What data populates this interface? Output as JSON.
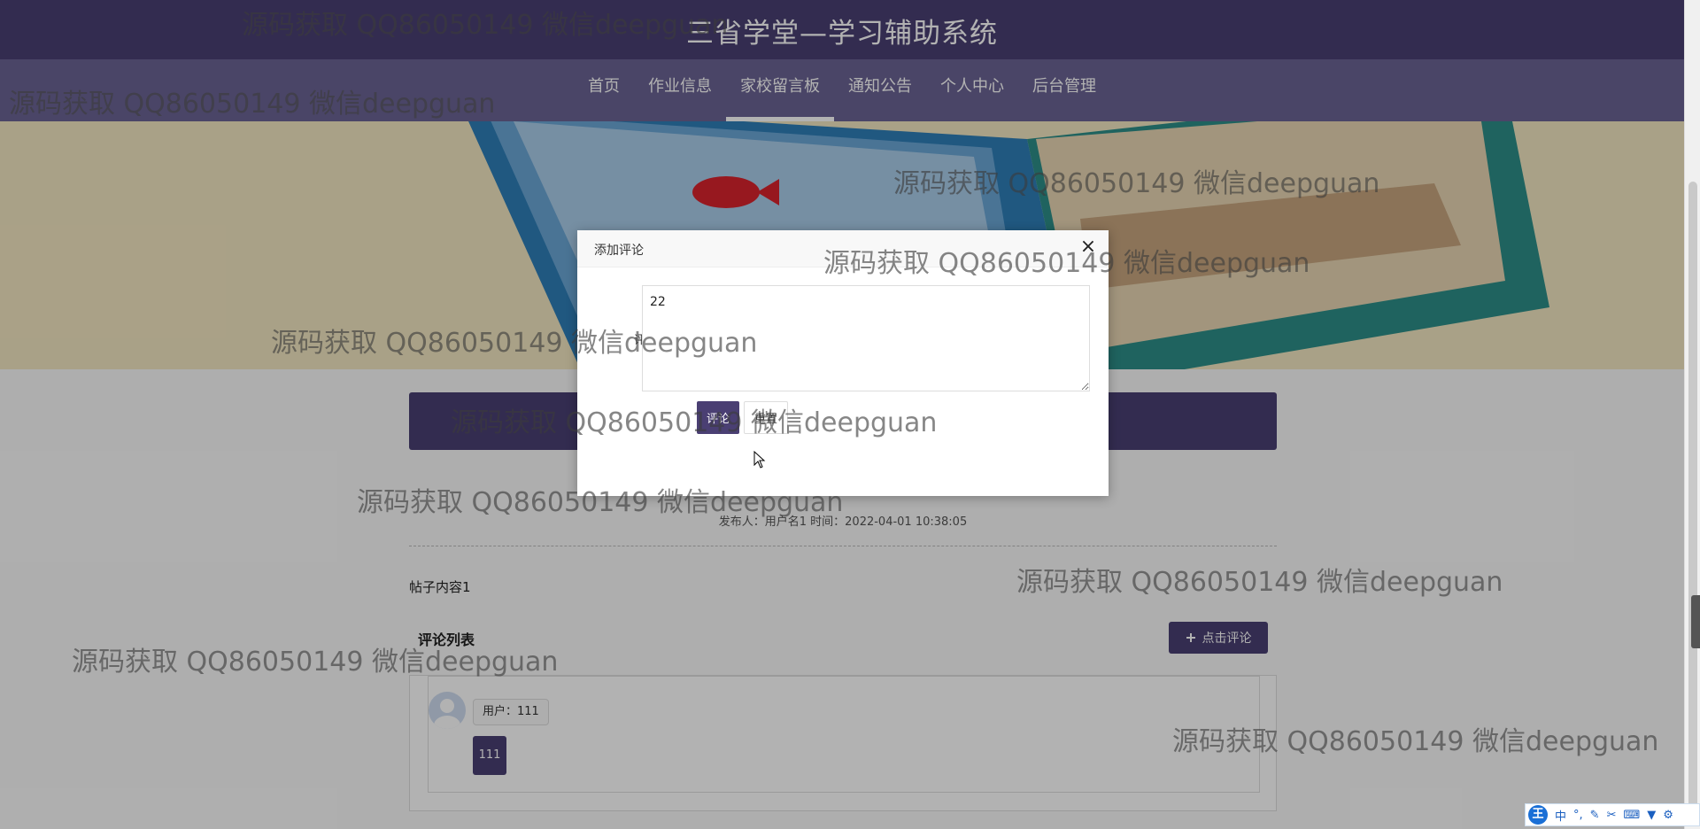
{
  "header": {
    "title": "三省学堂—学习辅助系统"
  },
  "nav": {
    "items": [
      {
        "label": "首页"
      },
      {
        "label": "作业信息"
      },
      {
        "label": "家校留言板"
      },
      {
        "label": "通知公告"
      },
      {
        "label": "个人中心"
      },
      {
        "label": "后台管理"
      }
    ],
    "active_index": 2
  },
  "post": {
    "meta": "发布人：用户名1 时间：2022-04-01 10:38:05",
    "content": "帖子内容1"
  },
  "comments": {
    "list_title": "评论列表",
    "add_button_label": "点击评论",
    "items": [
      {
        "user_label": "用户：111",
        "text": "111"
      }
    ]
  },
  "modal": {
    "title": "添加评论",
    "close_label": "×",
    "field_label": "评论",
    "textarea_value": "22",
    "submit_label": "评论",
    "reset_label": "重置"
  },
  "watermark": {
    "text": "源码获取 QQ86050149 微信deepguan"
  },
  "ime": {
    "logo_label": "王",
    "mode_label": "中",
    "icons": [
      "punctuation-icon",
      "pen-icon",
      "scissors-icon",
      "keyboard-icon",
      "skin-icon",
      "settings-icon"
    ]
  },
  "colors": {
    "primary": "#4a3f73",
    "nav_bg": "#6b6394",
    "banner_bg": "#f3e7c2"
  }
}
